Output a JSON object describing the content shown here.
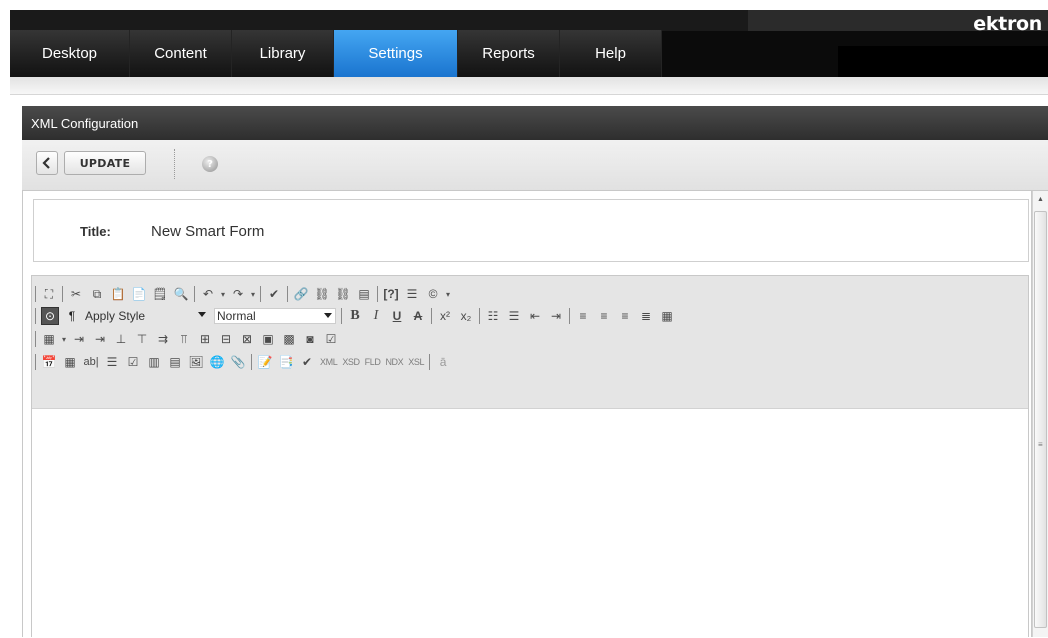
{
  "brand": "ektron",
  "nav": {
    "tabs": [
      "Desktop",
      "Content",
      "Library",
      "Settings",
      "Reports",
      "Help"
    ],
    "active": "Settings"
  },
  "panel": {
    "title": "XML Configuration",
    "toolbar": {
      "update_label": "UPDATE",
      "help_glyph": "?"
    }
  },
  "form": {
    "title_label": "Title:",
    "title_value": "New Smart Form"
  },
  "editor": {
    "apply_style": "Apply Style",
    "format_value": "Normal"
  },
  "colors": {
    "active_tab": "#2b8de6",
    "nav_bg": "#0b0b0b",
    "panel_header": "#3a3a3a"
  }
}
